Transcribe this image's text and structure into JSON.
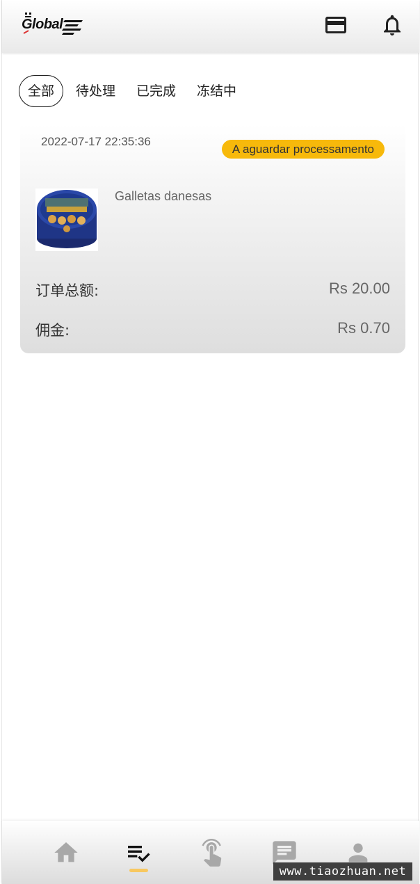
{
  "header": {
    "logo_text": "Global",
    "icons": [
      "credit-card-icon",
      "bell-icon"
    ]
  },
  "tabs": [
    {
      "label": "全部",
      "active": true
    },
    {
      "label": "待处理",
      "active": false
    },
    {
      "label": "已完成",
      "active": false
    },
    {
      "label": "冻结中",
      "active": false
    }
  ],
  "order": {
    "time": "2022-07-17 22:35:36",
    "status": "A aguardar processamento",
    "status_color": "#f7b90b",
    "product_name": "Galletas danesas",
    "total_label": "订单总额:",
    "total_value": "Rs 20.00",
    "commission_label": "佣金:",
    "commission_value": "Rs 0.70"
  },
  "bottom_nav": {
    "items": [
      "home-icon",
      "orders-icon",
      "grab-icon",
      "message-icon",
      "user-icon"
    ],
    "active": "orders-icon",
    "indicator_color": "#f8c860"
  },
  "watermark": "www.tiaozhuan.net"
}
